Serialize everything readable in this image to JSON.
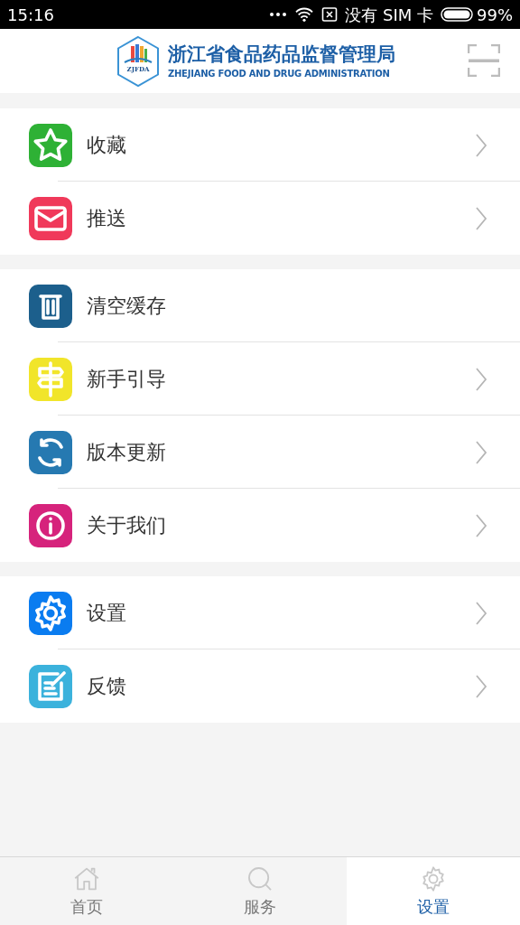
{
  "status_bar": {
    "time": "15:16",
    "carrier": "没有 SIM 卡",
    "battery": "99%"
  },
  "header": {
    "logo_text": "ZJFDA",
    "title": "浙江省食品药品监督管理局",
    "subtitle": "ZHEJIANG FOOD AND DRUG ADMINISTRATION"
  },
  "sections": [
    {
      "items": [
        {
          "label": "收藏",
          "kind": "star",
          "color": "#2eb135",
          "chevron": true
        },
        {
          "label": "推送",
          "kind": "mail",
          "color": "#f0395a",
          "chevron": true
        }
      ]
    },
    {
      "items": [
        {
          "label": "清空缓存",
          "kind": "trash",
          "color": "#1c5f8c",
          "chevron": false
        },
        {
          "label": "新手引导",
          "kind": "signpost",
          "color": "#f1e52a",
          "chevron": true
        },
        {
          "label": "版本更新",
          "kind": "refresh",
          "color": "#2679b1",
          "chevron": true
        },
        {
          "label": "关于我们",
          "kind": "info",
          "color": "#d6237c",
          "chevron": true
        }
      ]
    },
    {
      "items": [
        {
          "label": "设置",
          "kind": "gear",
          "color": "#0a7cf0",
          "chevron": true
        },
        {
          "label": "反馈",
          "kind": "edit",
          "color": "#3bb2dc",
          "chevron": true
        }
      ]
    }
  ],
  "tabs": [
    {
      "label": "首页",
      "kind": "home",
      "selected": false
    },
    {
      "label": "服务",
      "kind": "search",
      "selected": false
    },
    {
      "label": "设置",
      "kind": "gear",
      "selected": true
    }
  ]
}
